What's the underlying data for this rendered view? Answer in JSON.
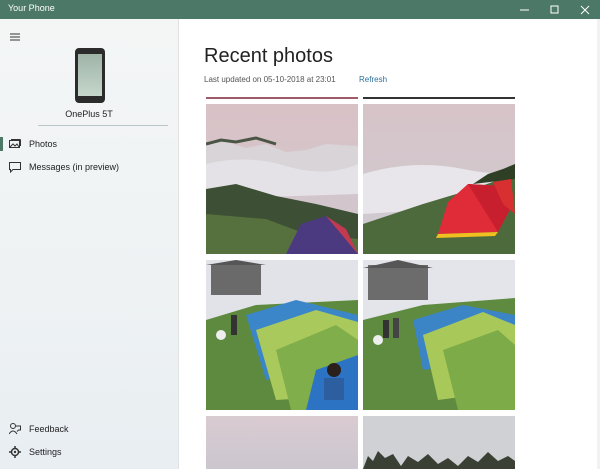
{
  "window": {
    "title": "Your Phone",
    "controls": [
      "minimize-icon",
      "maximize-icon",
      "close-icon"
    ]
  },
  "sidebar": {
    "menu_icon": "hamburger-icon",
    "device": {
      "name": "OnePlus 5T",
      "icon": "phone-icon"
    },
    "nav": [
      {
        "label": "Photos",
        "icon": "photos-icon",
        "active": true
      },
      {
        "label": "Messages (in preview)",
        "icon": "message-icon",
        "active": false
      }
    ],
    "bottom": [
      {
        "label": "Feedback",
        "icon": "feedback-icon"
      },
      {
        "label": "Settings",
        "icon": "gear-icon"
      }
    ]
  },
  "main": {
    "heading": "Recent photos",
    "updated": "Last updated on 05-10-2018 at 23:01",
    "refresh": "Refresh",
    "photos": [
      "mountain-clouds-tent",
      "campsite-red-tents",
      "campsite-tents-1",
      "campsite-tents-2",
      "sky-partial",
      "trees-partial"
    ]
  },
  "colors": {
    "titlebar": "#4c7868",
    "accent": "#2b6f9b"
  }
}
